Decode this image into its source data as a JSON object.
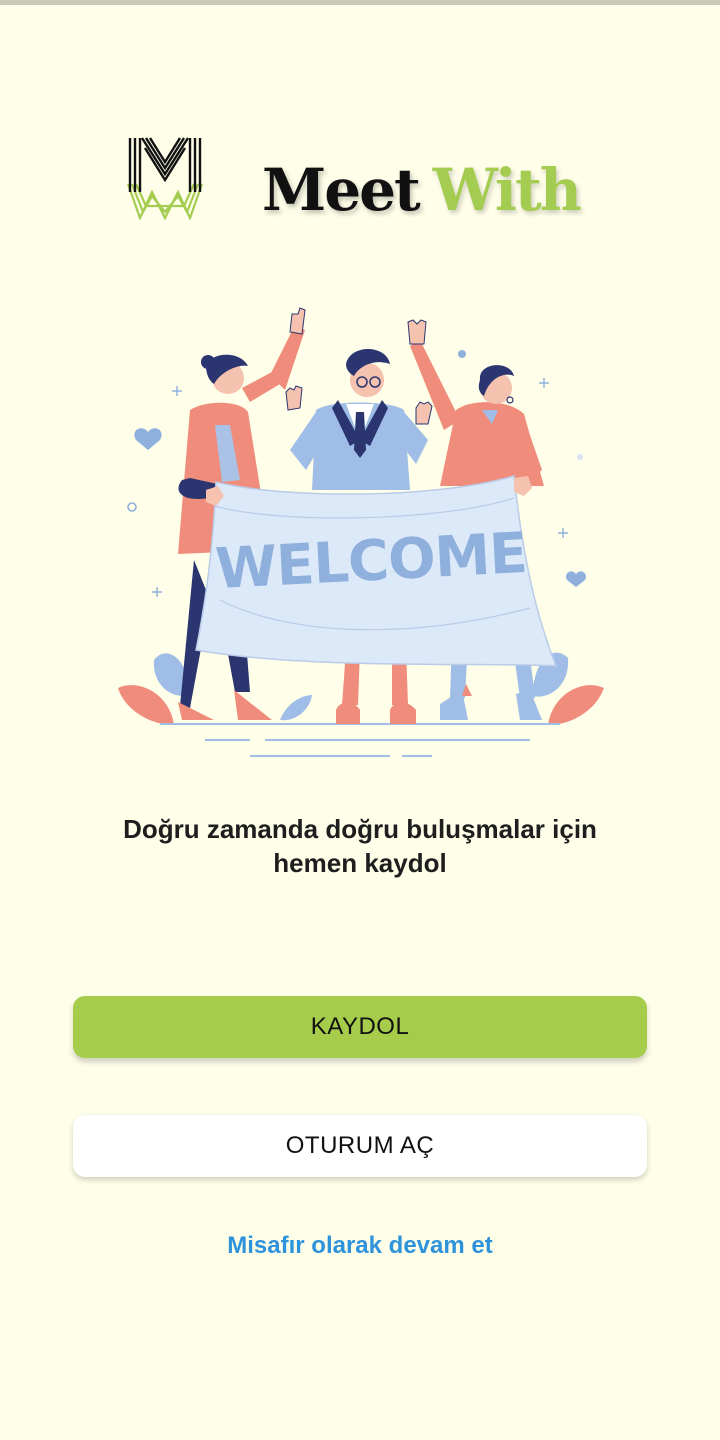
{
  "brand": {
    "logo_letter": "M",
    "name_part1": "Meet",
    "name_part2": "With"
  },
  "illustration": {
    "banner_text": "WELCOME"
  },
  "tagline": {
    "line1": "Doğru zamanda doğru buluşmalar için",
    "line2": "hemen kaydol"
  },
  "buttons": {
    "signup_label": "KAYDOL",
    "login_label": "OTURUM AÇ"
  },
  "guest_link": "Misafır olarak devam et",
  "colors": {
    "background": "#fefee9",
    "accent_green": "#a6cc4c",
    "link_blue": "#2f93dc",
    "brand_green": "#a3cc50"
  }
}
